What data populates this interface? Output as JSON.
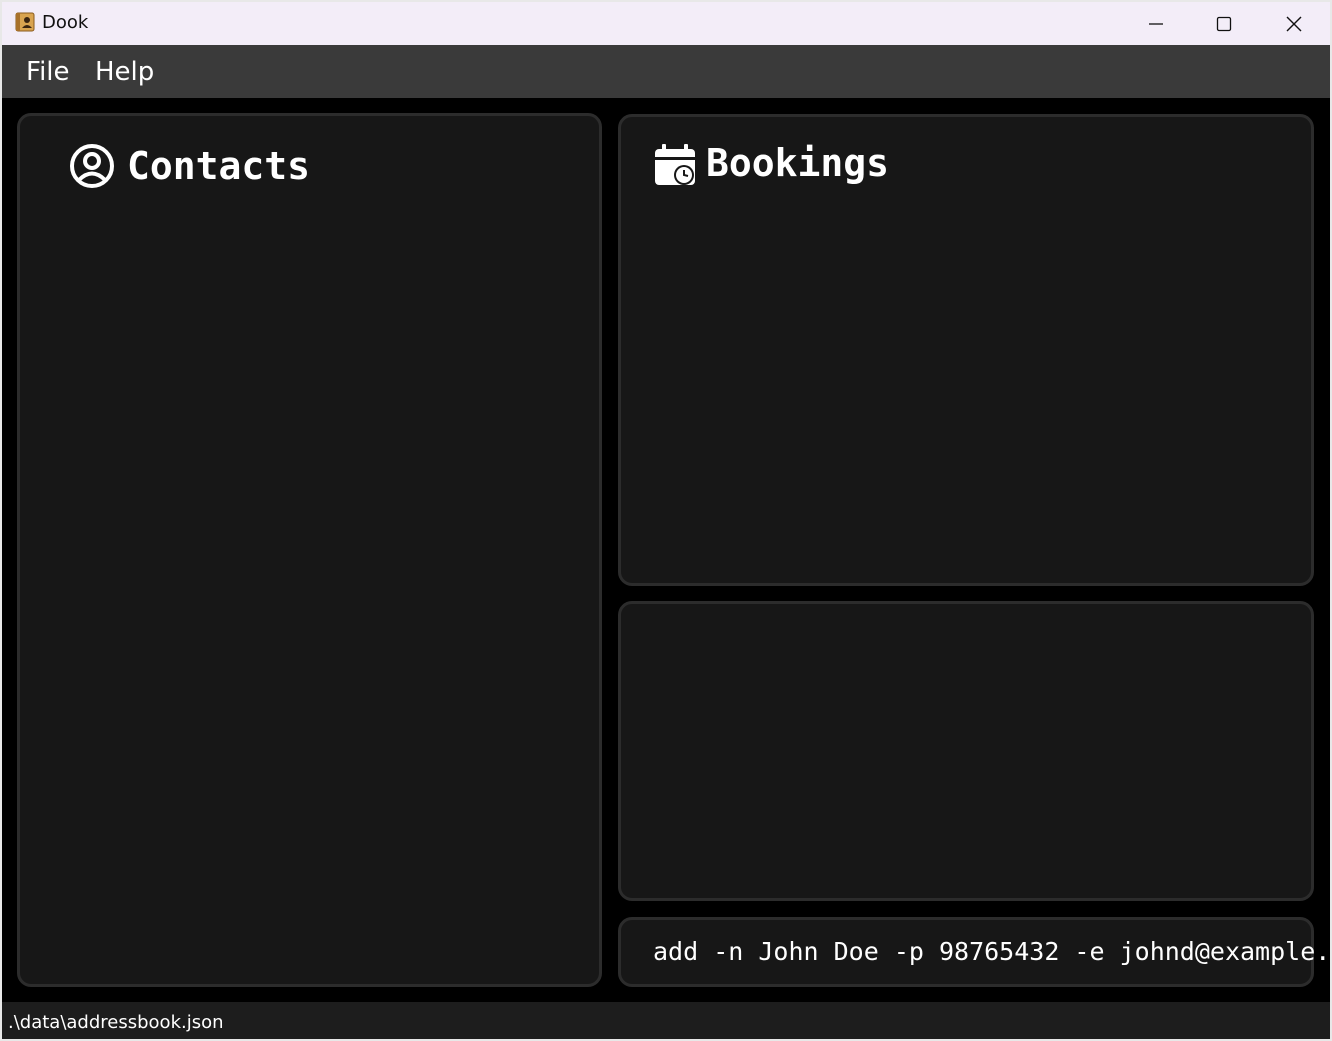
{
  "window": {
    "title": "Dook",
    "icon": "address-book-icon",
    "controls": [
      "minimize-icon",
      "maximize-icon",
      "close-icon"
    ]
  },
  "menu": {
    "items": [
      {
        "label": "File"
      },
      {
        "label": "Help"
      }
    ]
  },
  "contacts_panel": {
    "title": "Contacts",
    "icon": "user-circle-icon",
    "items": []
  },
  "bookings_panel": {
    "title": "Bookings",
    "icon": "calendar-clock-icon",
    "items": []
  },
  "result_panel": {
    "text": ""
  },
  "command_box": {
    "value": "add -n John Doe -p 98765432 -e johnd@example."
  },
  "status_bar": {
    "path": ".\\data\\addressbook.json"
  },
  "colors": {
    "background": "#000000",
    "panel": "#171717",
    "panel_border": "#2c2c2c",
    "menubar": "#3a3a3a",
    "titlebar": "#f3edf8",
    "text": "#ffffff"
  }
}
